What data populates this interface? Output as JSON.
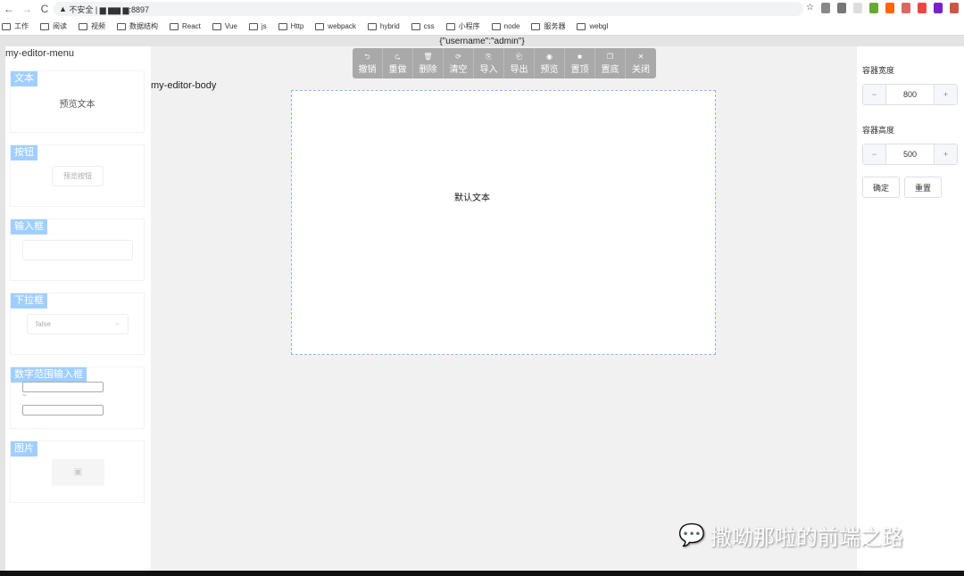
{
  "browser": {
    "url": "不安全 | ▆ ▆▆ ▆:8897",
    "bookmarks": [
      "工作",
      "阅读",
      "视频",
      "数据结构",
      "React",
      "Vue",
      "js",
      "Http",
      "webpack",
      "hybrid",
      "css",
      "小程序",
      "node",
      "服务器",
      "webgl"
    ],
    "ext_colors": [
      "#888",
      "#777",
      "#ddd",
      "#6a3",
      "#f60",
      "#d66",
      "#e44",
      "#72c",
      "#c54"
    ]
  },
  "user_json": "{\"username\":\"admin\"}",
  "menu": {
    "title": "my-editor-menu",
    "cards": [
      {
        "tag": "文本",
        "preview": "预览文本"
      },
      {
        "tag": "按钮",
        "preview": "预览按钮"
      },
      {
        "tag": "输入框"
      },
      {
        "tag": "下拉框",
        "preview": "false"
      },
      {
        "tag": "数字范围输入框",
        "sep": "~"
      },
      {
        "tag": "图片"
      }
    ]
  },
  "body": {
    "title": "my-editor-body",
    "canvas_text": "默认文本"
  },
  "toolbar": [
    {
      "icon": "⮌",
      "label": "撤销"
    },
    {
      "icon": "⮎",
      "label": "重做"
    },
    {
      "icon": "🗑",
      "label": "删除"
    },
    {
      "icon": "⟳",
      "label": "清空"
    },
    {
      "icon": "⎘",
      "label": "导入"
    },
    {
      "icon": "⎗",
      "label": "导出"
    },
    {
      "icon": "◉",
      "label": "预览"
    },
    {
      "icon": "■",
      "label": "置顶"
    },
    {
      "icon": "❐",
      "label": "置底"
    },
    {
      "icon": "✕",
      "label": "关闭"
    }
  ],
  "panel": {
    "width_label": "容器宽度",
    "width_value": "800",
    "height_label": "容器高度",
    "height_value": "500",
    "minus": "−",
    "plus": "+",
    "confirm": "确定",
    "reset": "重置"
  },
  "watermark": "撒呦那啦的前端之路"
}
